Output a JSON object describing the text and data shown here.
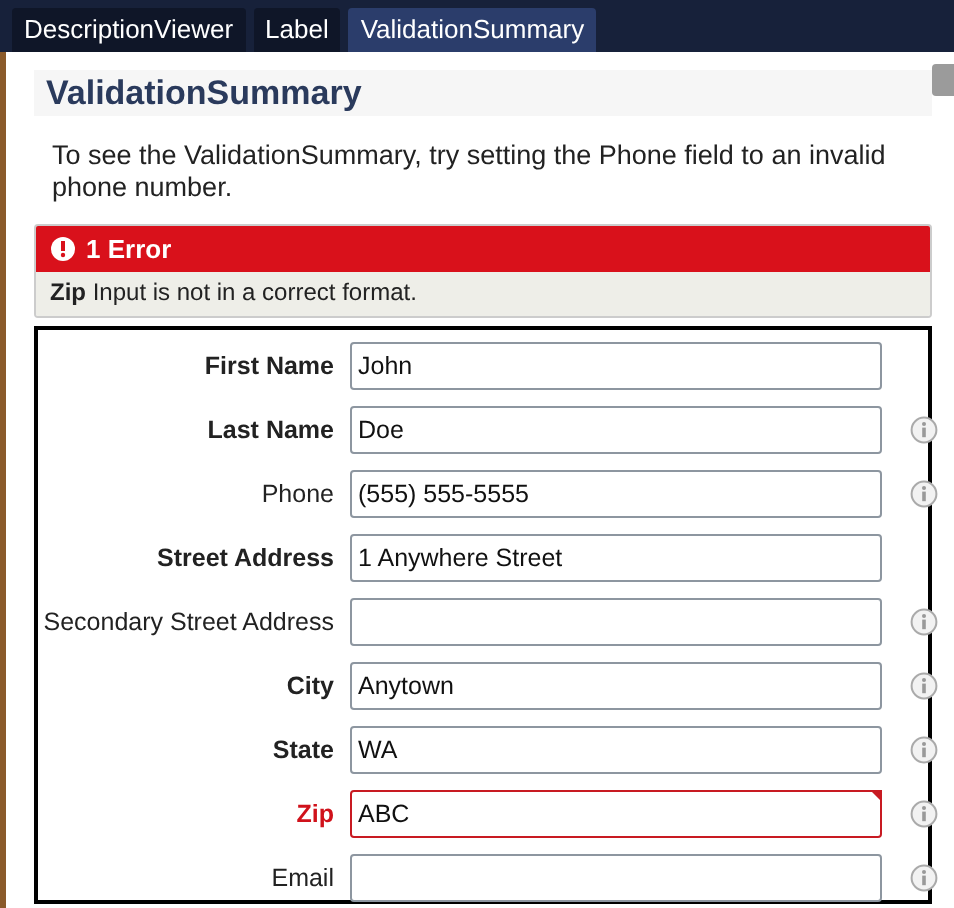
{
  "tabs": [
    {
      "label": "DescriptionViewer",
      "selected": false
    },
    {
      "label": "Label",
      "selected": false
    },
    {
      "label": "ValidationSummary",
      "selected": true
    }
  ],
  "heading": "ValidationSummary",
  "description": "To see the ValidationSummary, try setting the Phone field to an invalid phone number.",
  "validation_summary": {
    "title": "1 Error",
    "errors": [
      {
        "field": "Zip",
        "message": "Input is not in a correct format."
      }
    ]
  },
  "fields": [
    {
      "label": "First Name",
      "value": "John",
      "required": true,
      "error": false,
      "info": false
    },
    {
      "label": "Last Name",
      "value": "Doe",
      "required": true,
      "error": false,
      "info": true
    },
    {
      "label": "Phone",
      "value": "(555) 555-5555",
      "required": false,
      "error": false,
      "info": true
    },
    {
      "label": "Street Address",
      "value": "1 Anywhere Street",
      "required": true,
      "error": false,
      "info": false
    },
    {
      "label": "Secondary Street Address",
      "required": false,
      "error": false,
      "info": true
    },
    {
      "label": "City",
      "value": "Anytown",
      "required": true,
      "error": false,
      "info": true
    },
    {
      "label": "State",
      "value": "WA",
      "required": true,
      "error": false,
      "info": true
    },
    {
      "label": "Zip",
      "value": "ABC",
      "required": true,
      "error": true,
      "info": true
    },
    {
      "label": "Email",
      "required": false,
      "error": false,
      "info": true
    }
  ]
}
